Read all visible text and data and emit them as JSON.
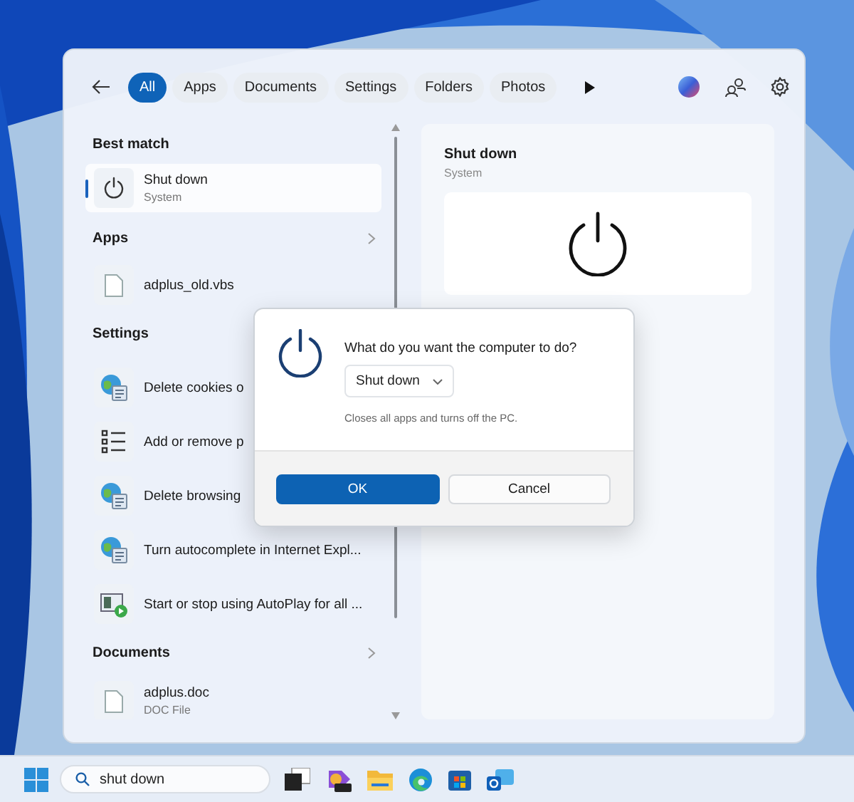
{
  "search_window": {
    "filters": [
      {
        "label": "All",
        "selected": true
      },
      {
        "label": "Apps",
        "selected": false
      },
      {
        "label": "Documents",
        "selected": false
      },
      {
        "label": "Settings",
        "selected": false
      },
      {
        "label": "Folders",
        "selected": false
      },
      {
        "label": "Photos",
        "selected": false
      }
    ],
    "best_match": {
      "heading": "Best match",
      "title": "Shut down",
      "subtitle": "System",
      "selected": true,
      "kind": "power"
    },
    "sections": [
      {
        "heading": "Apps",
        "items": [
          {
            "title": "adplus_old.vbs",
            "kind": "file"
          }
        ]
      },
      {
        "heading": "Settings",
        "items": [
          {
            "title": "Delete cookies o",
            "kind": "globe"
          },
          {
            "title": "Add or remove p",
            "kind": "list"
          },
          {
            "title": "Delete browsing",
            "kind": "globe"
          },
          {
            "title": "Turn autocomplete in Internet Expl...",
            "kind": "globe"
          },
          {
            "title": "Start or stop using AutoPlay for all ...",
            "kind": "autoplay"
          }
        ]
      },
      {
        "heading": "Documents",
        "items": [
          {
            "title": "adplus.doc",
            "subtitle": "DOC File",
            "kind": "file"
          }
        ]
      }
    ],
    "preview": {
      "title": "Shut down",
      "subtitle": "System"
    }
  },
  "dialog": {
    "question": "What do you want the computer to do?",
    "option": "Shut down",
    "description": "Closes all apps and turns off the PC.",
    "buttons": [
      {
        "label": "OK",
        "primary": true
      },
      {
        "label": "Cancel",
        "primary": false
      }
    ]
  },
  "taskbar": {
    "search_query": "shut down"
  }
}
